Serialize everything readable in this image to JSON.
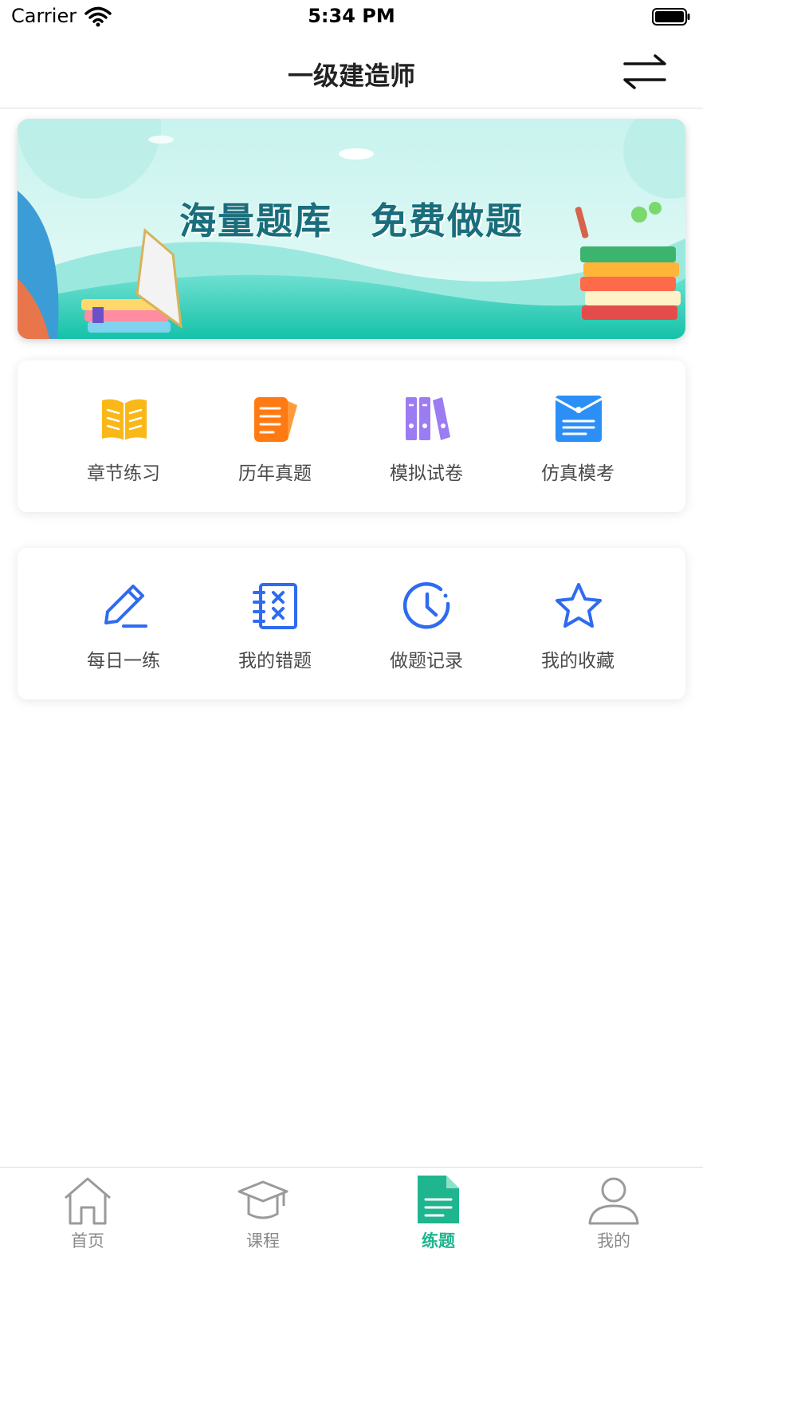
{
  "status_bar": {
    "carrier": "Carrier",
    "time": "5:34 PM"
  },
  "nav": {
    "title": "一级建造师",
    "switch_icon": "swap-arrows-icon"
  },
  "banner": {
    "headline": "海量题库　免费做题"
  },
  "practice_modes": [
    {
      "label": "章节练习",
      "icon": "open-book-icon",
      "color": "#F9B718"
    },
    {
      "label": "历年真题",
      "icon": "papers-icon",
      "color": "#FF7A12"
    },
    {
      "label": "模拟试卷",
      "icon": "binders-icon",
      "color": "#9C7CF2"
    },
    {
      "label": "仿真模考",
      "icon": "exam-envelope-icon",
      "color": "#2C8FF6"
    }
  ],
  "tools": [
    {
      "label": "每日一练",
      "icon": "pencil-icon"
    },
    {
      "label": "我的错题",
      "icon": "wrong-notebook-icon"
    },
    {
      "label": "做题记录",
      "icon": "clock-icon"
    },
    {
      "label": "我的收藏",
      "icon": "star-icon"
    }
  ],
  "tool_color": "#2F6BF0",
  "tabs": [
    {
      "label": "首页",
      "icon": "home-icon",
      "active": false
    },
    {
      "label": "课程",
      "icon": "graduation-cap-icon",
      "active": false
    },
    {
      "label": "练题",
      "icon": "document-icon",
      "active": true
    },
    {
      "label": "我的",
      "icon": "user-icon",
      "active": false
    }
  ],
  "accent_color": "#1FB58F"
}
